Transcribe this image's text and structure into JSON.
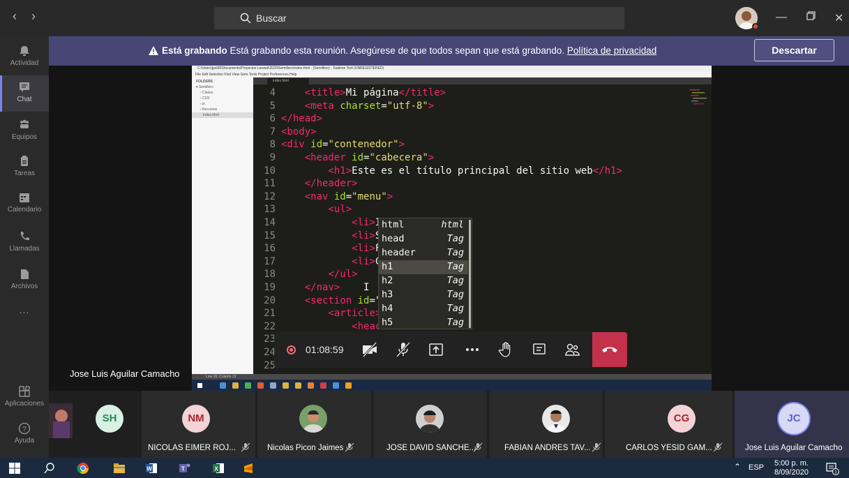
{
  "search": {
    "placeholder": "Buscar"
  },
  "rail": {
    "items": [
      {
        "label": "Actividad",
        "icon": "bell-icon"
      },
      {
        "label": "Chat",
        "icon": "chat-icon"
      },
      {
        "label": "Equipos",
        "icon": "teams-icon"
      },
      {
        "label": "Tareas",
        "icon": "assignments-icon"
      },
      {
        "label": "Calendario",
        "icon": "calendar-icon"
      },
      {
        "label": "Llamadas",
        "icon": "phone-icon"
      },
      {
        "label": "Archivos",
        "icon": "files-icon"
      },
      {
        "label": "...",
        "icon": "more-icon"
      }
    ],
    "apps_label": "Aplicaciones",
    "help_label": "Ayuda"
  },
  "banner": {
    "bold": "Está grabando",
    "text": " Está grabando esta reunión. Asegúrese de que todos sepan que está grabando. ",
    "link": "Política de privacidad",
    "dismiss": "Descartar"
  },
  "shared_screen": {
    "window_title": "C:\\Users\\jpol39\\Documents\\Proyectos Laravel\\2020\\Semillero\\index.html - (Semillero) - Sublime Text (UNREGISTERED)",
    "menu": "File  Edit  Selection  Find  View  Goto  Tools  Project  Preferences  Help",
    "folders_header": "FOLDERS",
    "folders": [
      "▾ Semillero",
      "› Clases",
      "› CSS",
      "› js",
      "› Recursos",
      "index.html"
    ],
    "tab": "index.html",
    "status": "Line 20, Column 15",
    "code_lines": [
      {
        "n": "4",
        "html": "    <span class='tg'>&lt;title&gt;</span>Mi página<span class='tg'>&lt;/title&gt;</span>"
      },
      {
        "n": "5",
        "html": "    <span class='tg'>&lt;meta</span> <span class='at'>charset</span>=<span class='st'>\"utf-8\"</span><span class='tg'>&gt;</span>"
      },
      {
        "n": "6",
        "html": "<span class='tg'>&lt;/head&gt;</span>"
      },
      {
        "n": "7",
        "html": "<span class='tg'>&lt;body&gt;</span>"
      },
      {
        "n": "8",
        "html": "<span class='tg'>&lt;div</span> <span class='at'>id</span>=<span class='st'>\"contenedor\"</span><span class='tg'>&gt;</span>"
      },
      {
        "n": "9",
        "html": "    <span class='tg'>&lt;header</span> <span class='at'>id</span>=<span class='st'>\"cabecera\"</span><span class='tg'>&gt;</span>"
      },
      {
        "n": "10",
        "html": "        <span class='tg'>&lt;h1&gt;</span>Este es el título principal del sitio web<span class='tg'>&lt;/h1&gt;</span>"
      },
      {
        "n": "11",
        "html": "    <span class='tg'>&lt;/header&gt;</span>"
      },
      {
        "n": "12",
        "html": "    <span class='tg'>&lt;nav</span> <span class='at'>id</span>=<span class='st'>\"menu\"</span><span class='tg'>&gt;</span>"
      },
      {
        "n": "13",
        "html": "        <span class='tg'>&lt;ul&gt;</span>"
      },
      {
        "n": "14",
        "html": "            <span class='tg'>&lt;li&gt;</span>I"
      },
      {
        "n": "15",
        "html": "            <span class='tg'>&lt;li&gt;</span>S"
      },
      {
        "n": "16",
        "html": "            <span class='tg'>&lt;li&gt;</span>F"
      },
      {
        "n": "17",
        "html": "            <span class='tg'>&lt;li&gt;</span>C"
      },
      {
        "n": "18",
        "html": "        <span class='tg'>&lt;/ul&gt;</span>"
      },
      {
        "n": "19",
        "html": "    <span class='tg'>&lt;/nav&gt;</span>    I"
      },
      {
        "n": "20",
        "html": "    <span class='tg'>&lt;section</span> <span class='at'>id</span>=\""
      },
      {
        "n": "21",
        "html": "        <span class='tg'>&lt;article&gt;</span>"
      },
      {
        "n": "22",
        "html": "            <span class='tg'>&lt;heac</span>"
      },
      {
        "n": "23",
        "html": ""
      },
      {
        "n": "24",
        "html": ""
      },
      {
        "n": "25",
        "html": ""
      }
    ],
    "autocomplete": [
      {
        "word": "html",
        "type": "html"
      },
      {
        "word": "head",
        "type": "Tag"
      },
      {
        "word": "header",
        "type": "Tag"
      },
      {
        "word": "h1",
        "type": "Tag"
      },
      {
        "word": "h2",
        "type": "Tag"
      },
      {
        "word": "h3",
        "type": "Tag"
      },
      {
        "word": "h4",
        "type": "Tag"
      },
      {
        "word": "h5",
        "type": "Tag"
      }
    ]
  },
  "call": {
    "timer": "01:08:59",
    "presenter": "Jose Luis Aguilar Camacho"
  },
  "participants": [
    {
      "initials": "SH",
      "name": "",
      "color": "#2b2b2b",
      "fg": "#5fb88f",
      "avatar_bg": "#d9f0e4"
    },
    {
      "initials": "NM",
      "name": "NICOLAS EIMER ROJ...",
      "color": "#2b2b2b",
      "fg": "#b03a52",
      "avatar_bg": "#f3d3d8"
    },
    {
      "initials": "",
      "name": "Nicolas Picon Jaimes",
      "photo": true
    },
    {
      "initials": "",
      "name": "JOSE DAVID SANCHE...",
      "photo": true
    },
    {
      "initials": "",
      "name": "FABIAN ANDRES TAV...",
      "photo": true
    },
    {
      "initials": "CG",
      "name": "CARLOS YESID GAM...",
      "fg": "#b03a52",
      "avatar_bg": "#f3d3d8"
    },
    {
      "initials": "JC",
      "name": "Jose Luis Aguilar Camacho",
      "fg": "#5b5fc7",
      "avatar_bg": "#d7d9f5"
    }
  ],
  "taskbar": {
    "lang": "ESP",
    "time": "5:00 p. m.",
    "date": "8/09/2020"
  },
  "colors": {
    "banner": "#464775",
    "hangup": "#c4314b",
    "accent": "#7b83eb"
  }
}
